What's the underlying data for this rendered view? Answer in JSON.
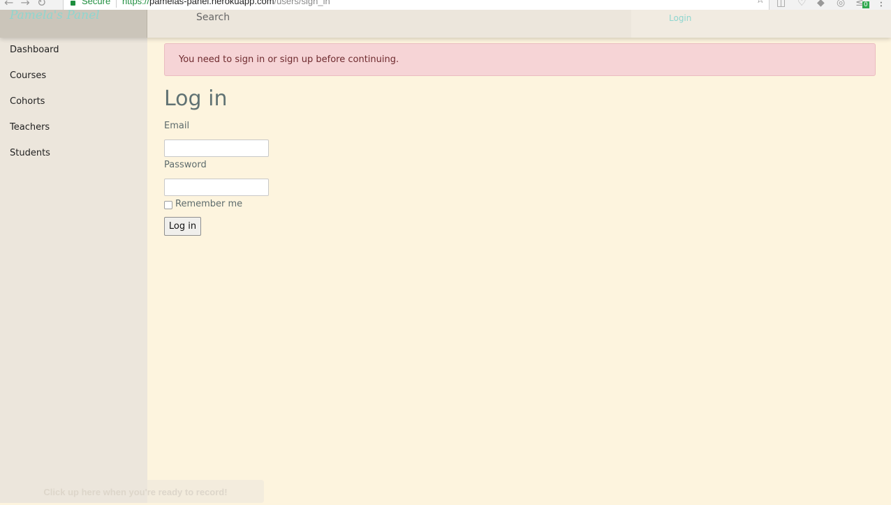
{
  "browser": {
    "secure_label": "Secure",
    "url_scheme": "https://",
    "url_host": "pamelas-panel.herokuapp.com",
    "url_path": "/users/sign_in",
    "extension_badge": "0"
  },
  "header": {
    "brand": "Pamela's Panel",
    "search_label": "Search",
    "login_label": "Login"
  },
  "sidebar": {
    "items": [
      {
        "label": "Dashboard"
      },
      {
        "label": "Courses"
      },
      {
        "label": "Cohorts"
      },
      {
        "label": "Teachers"
      },
      {
        "label": "Students"
      }
    ]
  },
  "alert": {
    "message": "You need to sign in or sign up before continuing."
  },
  "login_form": {
    "title": "Log in",
    "email_label": "Email",
    "email_value": "",
    "password_label": "Password",
    "password_value": "",
    "remember_label": "Remember me",
    "remember_checked": false,
    "submit_label": "Log in"
  },
  "recorder": {
    "hint": "Click up here when you're ready to record!"
  },
  "colors": {
    "accent": "#8ed6cf",
    "page_bg": "#fdf4de",
    "sidebar_bg": "#ece6dc",
    "alert_bg": "#f6d4d6",
    "alert_text": "#6e2a2e",
    "title_color": "#607273"
  }
}
